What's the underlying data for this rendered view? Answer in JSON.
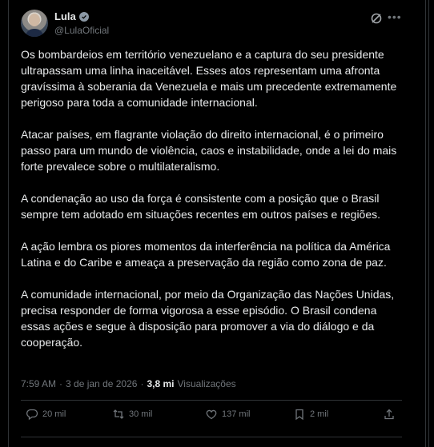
{
  "author": {
    "display_name": "Lula",
    "handle": "@LulaOficial"
  },
  "icons": {
    "verified": "verified-badge-icon",
    "grok": "grok-icon",
    "more": "more-options-icon",
    "reply": "reply-icon",
    "repost": "repost-icon",
    "like": "like-icon",
    "bookmark": "bookmark-icon",
    "share": "share-icon"
  },
  "post": {
    "paragraphs": [
      "Os bombardeios em território venezuelano e a captura do seu presidente ultrapassam uma linha inaceitável. Esses atos representam uma afronta gravíssima à soberania da Venezuela e mais um precedente extremamente perigoso para toda a comunidade internacional.",
      "Atacar países, em flagrante violação do direito internacional, é o primeiro passo para um mundo de violência, caos e instabilidade, onde a lei do mais forte prevalece sobre o multilateralismo.",
      "A condenação ao uso da força é consistente com a posição que o Brasil sempre tem adotado em situações recentes em outros países e regiões.",
      "A ação lembra os piores momentos da interferência na política da América Latina e do Caribe e ameaça a preservação da região como zona de paz.",
      "A comunidade internacional, por meio da Organização das Nações Unidas, precisa responder de forma vigorosa a esse episódio. O Brasil condena essas ações e segue à disposição para promover a via do diálogo e da cooperação."
    ]
  },
  "meta": {
    "time": "7:59 AM",
    "separator": "·",
    "date": "3 de jan de 2026",
    "views_count": "3,8 mi",
    "views_label": "Visualizações"
  },
  "actions": {
    "replies": "20 mil",
    "reposts": "30 mil",
    "likes": "137 mil",
    "bookmarks": "2 mil"
  },
  "colors": {
    "background": "#000000",
    "text": "#e7e9ea",
    "secondary": "#71767b",
    "border": "#2f3336"
  }
}
